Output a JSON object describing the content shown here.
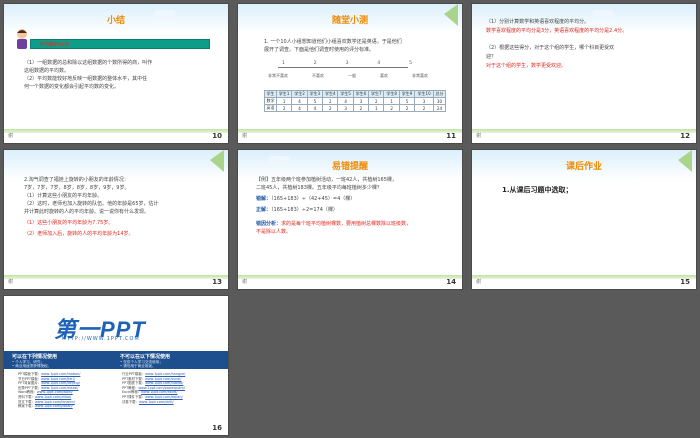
{
  "slides": [
    {
      "number": "10",
      "title": "小结",
      "badge": "平均数的认识",
      "lines": [
        "（1）一组数据的总和除以这组数据的个数所得的商，叫作",
        "这组数据的平均数。",
        "（2）平均数能较好地反映一组数据的整体水平，其中任",
        "何一个数据的变化都会引起平均数的变化。"
      ],
      "footer": "谢"
    },
    {
      "number": "11",
      "title": "随堂小测",
      "lines": [
        "1. 一个10人小组想知道他们小组喜欢数学还是英语，于是他们",
        "展开了调查。下面是他们调查时使用的评分标准。"
      ],
      "scale_nums": [
        "1",
        "2",
        "3",
        "4",
        "5"
      ],
      "scale_labels": [
        "非常不喜欢",
        "不喜欢",
        "一般",
        "喜欢",
        "非常喜欢"
      ],
      "table": [
        [
          "学生",
          "学生1",
          "学生2",
          "学生3",
          "学生4",
          "学生5",
          "学生6",
          "学生7",
          "学生8",
          "学生9",
          "学生10",
          "总分"
        ],
        [
          "数学",
          "1",
          "4",
          "5",
          "2",
          "4",
          "3",
          "2",
          "1",
          "5",
          "3",
          "30"
        ],
        [
          "英语",
          "2",
          "4",
          "4",
          "2",
          "3",
          "2",
          "1",
          "2",
          "2",
          "2",
          "24"
        ]
      ],
      "footer": "谢"
    },
    {
      "number": "12",
      "lines": [
        "（1）分别计算数学和英语喜欢程度的平均分。",
        "数学喜欢程度的平均分是3分，英语喜欢程度的平均分是2.4分。",
        "（2）根据这些得分，对于这个组的学生，哪个科目更受欢",
        "迎？",
        "对于这个组的学生，数学更受欢迎。"
      ],
      "footer": "谢"
    },
    {
      "number": "13",
      "lines": [
        "2.淘气调查了福娃上旋转的小朋友的年龄情况：",
        "7岁，7岁，7岁，8岁，8岁，8岁，9岁，9岁。",
        "（1）计算这些小朋友的平均年龄。",
        "（2）这时，老师也加入旋转的队伍。他的年龄是65岁，估计",
        "并计算此时旋转的人的平均年龄。说一说你有什么发现。",
        "（1）这些小朋友的平均年龄为7.75岁。",
        "（2）老师加入后，旋转的人的平均年龄为14岁。"
      ],
      "footer": "谢"
    },
    {
      "number": "14",
      "title": "易错提醒",
      "lines": [
        "【例】五年级两个班参加植树活动，一班42人，共植树165棵，",
        "二班45人，共植树183棵。五年级平均每班植树多少棵？",
        "错解：",
        "（165+183）÷（42+45）=4（棵）",
        "正解：",
        "（165+183）÷2=174（棵）",
        "错因分析：",
        "求的是每个班平均植树棵数，要用植树总棵数除以班级数，",
        "不是除以人数。"
      ],
      "footer": "谢"
    },
    {
      "number": "15",
      "title": "课后作业",
      "lines": [
        "1.从课后习题中选取；"
      ],
      "footer": "谢"
    },
    {
      "number": "16",
      "logo": "第一PPT",
      "logo_url": "HTTP://WWW.1PPT.COM",
      "left_head": "可以在下列情况使用",
      "right_head": "不可以在以下情况使用",
      "left_sub": [
        "• 个人学习、研究；",
        "• 商业用途须获得授权。"
      ],
      "right_sub": [
        "• 仅供个人学习交流使用；",
        "• 请勿用于商业用途。"
      ],
      "left_links": [
        [
          "PPT模板下载：",
          "www.1ppt.com/moban/"
        ],
        [
          "节日PPT模板：",
          "www.1ppt.com/jieri/"
        ],
        [
          "PPT背景图片：",
          "www.1ppt.com/beijing/"
        ],
        [
          "优秀PPT下载：",
          "www.1ppt.com/xiazai/"
        ],
        [
          "Word教程：",
          "www.1ppt.com/word/"
        ],
        [
          "资料下载：",
          "www.1ppt.com/ziliao/"
        ],
        [
          "范文下载：",
          "www.1ppt.com/fanwen/"
        ],
        [
          "教案下载：",
          "www.1ppt.com/jiaoan/"
        ]
      ],
      "right_links": [
        [
          "行业PPT模板：",
          "www.1ppt.com/hangye/"
        ],
        [
          "PPT素材下载：",
          "www.1ppt.com/sucai/"
        ],
        [
          "PPT图表下载：",
          "www.1ppt.com/tubiao/"
        ],
        [
          "PPT教程：",
          "www.1ppt.com/powerpoint/"
        ],
        [
          "Excel教程：",
          "www.1ppt.com/excel/"
        ],
        [
          "PPT课件下载：",
          "www.1ppt.com/kejian/"
        ],
        [
          "试卷下载：",
          "www.1ppt.com/shiti/"
        ]
      ]
    }
  ]
}
